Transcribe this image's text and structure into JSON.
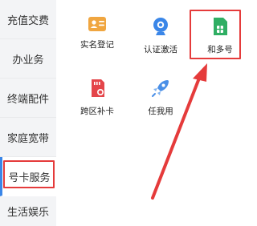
{
  "sidebar": {
    "items": [
      {
        "label": "充值交费"
      },
      {
        "label": "办业务"
      },
      {
        "label": "终端配件"
      },
      {
        "label": "家庭宽带"
      },
      {
        "label": "号卡服务"
      },
      {
        "label": "生活娱乐"
      }
    ],
    "active_index": 4
  },
  "services": [
    {
      "label": "实名登记",
      "icon": "id-card-icon",
      "color": "#f0a640"
    },
    {
      "label": "认证激活",
      "icon": "camera-icon",
      "color": "#3a86e8"
    },
    {
      "label": "和多号",
      "icon": "sim-card-icon",
      "color": "#2fae63"
    },
    {
      "label": "跨区补卡",
      "icon": "sd-card-icon",
      "color": "#e4454a"
    },
    {
      "label": "任我用",
      "icon": "rocket-icon",
      "color": "#4a8fe7"
    }
  ],
  "annotations": {
    "highlight_color": "#e53b3b"
  }
}
